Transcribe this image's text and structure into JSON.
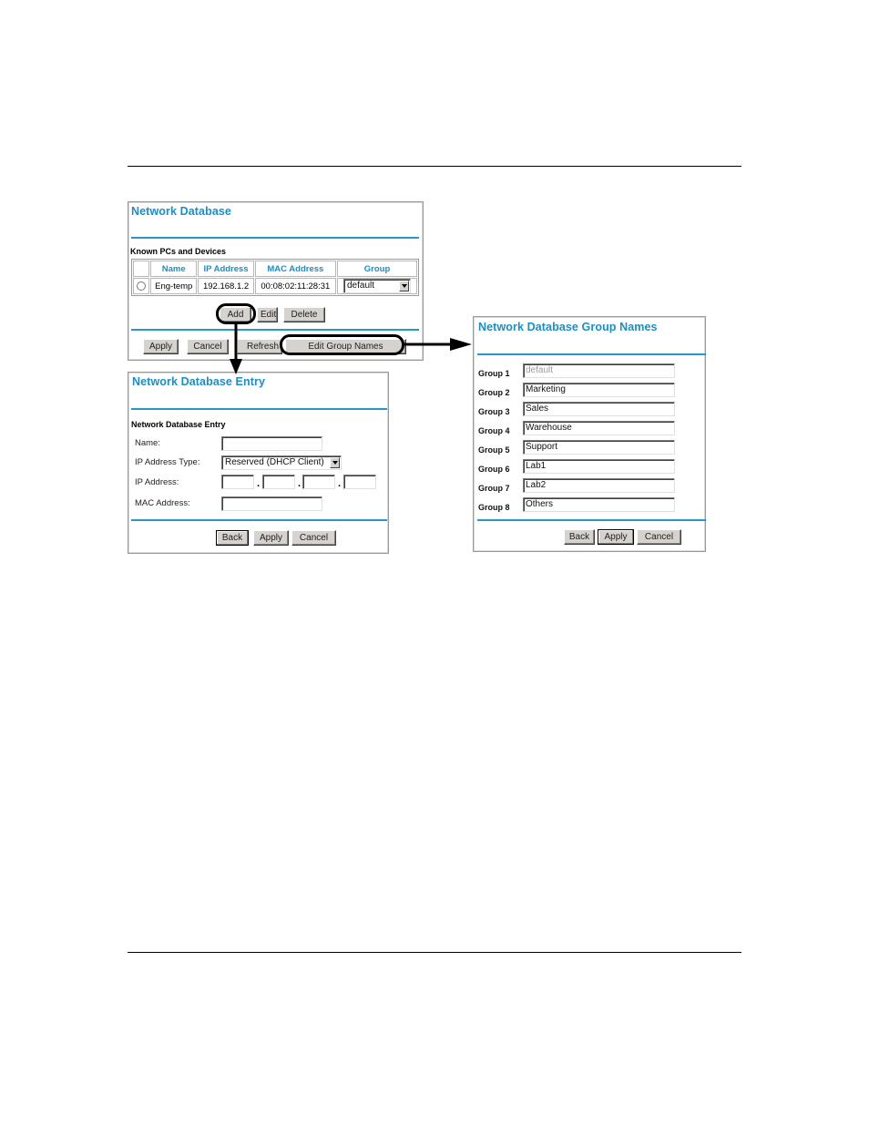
{
  "network_database": {
    "title": "Network Database",
    "section": "Known PCs and Devices",
    "columns": [
      "",
      "Name",
      "IP Address",
      "MAC Address",
      "Group"
    ],
    "rows": [
      {
        "selected": false,
        "name": "Eng-temp",
        "ip": "192.168.1.2",
        "mac": "00:08:02:11:28:31",
        "group": "default"
      }
    ],
    "buttons": {
      "add": "Add",
      "edit": "Edit",
      "delete": "Delete",
      "apply": "Apply",
      "cancel": "Cancel",
      "refresh": "Refresh",
      "edit_group_names": "Edit Group Names"
    }
  },
  "entry": {
    "title": "Network Database Entry",
    "section": "Network Database Entry",
    "fields": {
      "name_label": "Name:",
      "name_value": "",
      "ip_type_label": "IP Address Type:",
      "ip_type_value": "Reserved (DHCP Client)",
      "ip_label": "IP Address:",
      "ip_octets": [
        "",
        "",
        "",
        ""
      ],
      "ip_sep": ".",
      "mac_label": "MAC Address:",
      "mac_value": ""
    },
    "buttons": {
      "back": "Back",
      "apply": "Apply",
      "cancel": "Cancel"
    }
  },
  "group_names": {
    "title": "Network Database Group Names",
    "groups": [
      {
        "label": "Group 1",
        "value": "default",
        "disabled": true
      },
      {
        "label": "Group 2",
        "value": "Marketing"
      },
      {
        "label": "Group 3",
        "value": "Sales"
      },
      {
        "label": "Group 4",
        "value": "Warehouse"
      },
      {
        "label": "Group 5",
        "value": "Support"
      },
      {
        "label": "Group 6",
        "value": "Lab1"
      },
      {
        "label": "Group 7",
        "value": "Lab2"
      },
      {
        "label": "Group 8",
        "value": "Others"
      }
    ],
    "buttons": {
      "back": "Back",
      "apply": "Apply",
      "cancel": "Cancel"
    }
  },
  "colors": {
    "accent": "#1a8fc7",
    "rule": "#2a97c8",
    "button_face": "#d6d3ce"
  }
}
